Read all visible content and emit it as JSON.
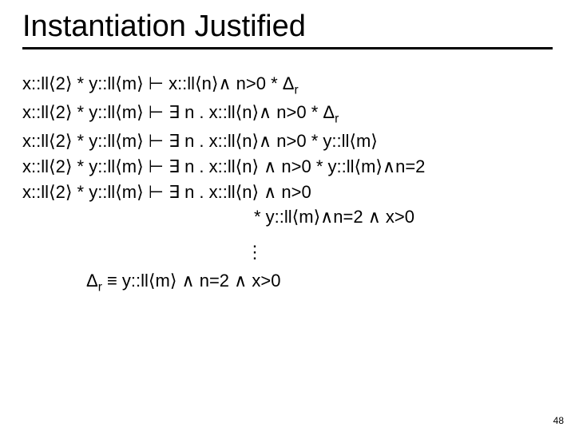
{
  "title": "Instantiation Justified",
  "lines": {
    "l1": "x::ll⟨2⟩ * y::ll⟨m⟩ ⊢  x::ll⟨n⟩∧ n>0 * Δ",
    "l1sub": "r",
    "l2": "x::ll⟨2⟩ * y::ll⟨m⟩ ⊢  ∃ n . x::ll⟨n⟩∧ n>0 * Δ",
    "l2sub": "r",
    "l3": "x::ll⟨2⟩ * y::ll⟨m⟩ ⊢  ∃ n . x::ll⟨n⟩∧ n>0 * y::ll⟨m⟩",
    "l4": "x::ll⟨2⟩ * y::ll⟨m⟩ ⊢  ∃ n . x::ll⟨n⟩ ∧ n>0 * y::ll⟨m⟩∧n=2",
    "l5": "x::ll⟨2⟩ * y::ll⟨m⟩ ⊢  ∃ n . x::ll⟨n⟩ ∧ n>0",
    "l5b": "* y::ll⟨m⟩∧n=2 ∧ x>0",
    "vdots": "⋮",
    "defL": "Δ",
    "defSub": "r",
    "defR": " ≡ y::ll⟨m⟩ ∧ n=2 ∧ x>0"
  },
  "page": "48"
}
